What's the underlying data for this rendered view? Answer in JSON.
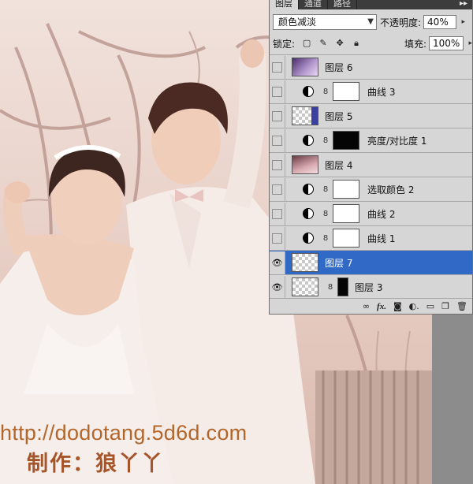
{
  "watermark": {
    "url": "http://dodotang.5d6d.com",
    "author": "制作：狼丫丫"
  },
  "layers_panel": {
    "tabs": [
      {
        "label": "图层",
        "active": true
      },
      {
        "label": "通道",
        "active": false
      },
      {
        "label": "路径",
        "active": false
      }
    ],
    "blend_mode": "颜色减淡",
    "opacity_label": "不透明度:",
    "opacity_value": "40%",
    "lock_label": "锁定:",
    "fill_label": "填充:",
    "fill_value": "100%",
    "layers": [
      {
        "name": "图层 6",
        "type": "pixel",
        "visible": false,
        "thumb": "purple"
      },
      {
        "name": "曲线 3",
        "type": "adjustment",
        "visible": false,
        "mask": "white"
      },
      {
        "name": "图层 5",
        "type": "pixel",
        "visible": false,
        "thumb": "checker-blue"
      },
      {
        "name": "亮度/对比度 1",
        "type": "adjustment",
        "visible": false,
        "mask": "black"
      },
      {
        "name": "图层 4",
        "type": "pixel",
        "visible": false,
        "thumb": "pink"
      },
      {
        "name": "选取颜色 2",
        "type": "adjustment",
        "visible": false,
        "mask": "white"
      },
      {
        "name": "曲线 2",
        "type": "adjustment",
        "visible": false,
        "mask": "white"
      },
      {
        "name": "曲线 1",
        "type": "adjustment",
        "visible": false,
        "mask": "white"
      },
      {
        "name": "图层 7",
        "type": "pixel",
        "visible": true,
        "selected": true,
        "thumb": "checker"
      },
      {
        "name": "图层 3",
        "type": "pixel",
        "visible": true,
        "thumb": "checker"
      }
    ],
    "footer_icons": [
      "link-icon",
      "fx-icon",
      "add-mask-icon",
      "adjustment-icon",
      "group-folder-icon",
      "new-layer-icon",
      "trash-icon"
    ]
  },
  "colors": {
    "selected_row": "#3169c6",
    "watermark": "#b4662a",
    "panel_bg": "#d6d6d6"
  }
}
